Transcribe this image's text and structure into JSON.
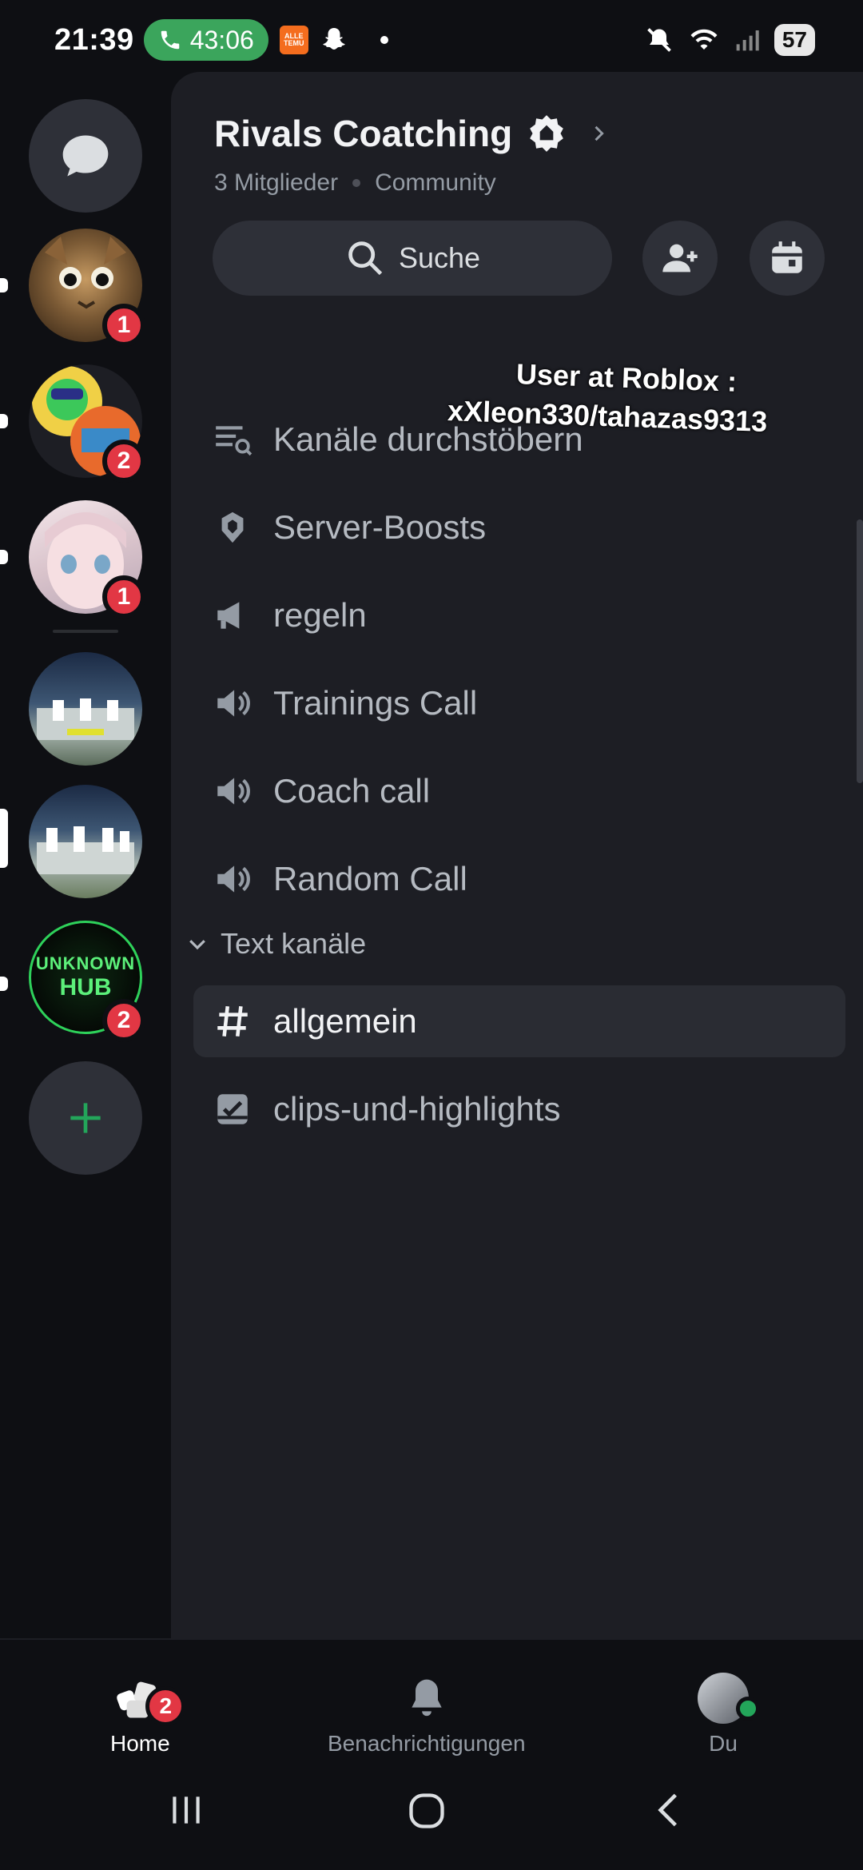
{
  "status_bar": {
    "time": "21:39",
    "call_timer": "43:06",
    "temu_label": "ALLE TEMU",
    "battery": "57"
  },
  "server": {
    "name": "Rivals Coatching",
    "members": "3 Mitglieder",
    "type": "Community"
  },
  "search": {
    "label": "Suche"
  },
  "rail": {
    "badges": [
      "1",
      "2",
      "1",
      "2"
    ],
    "hub_text_1": "UNKNOWN",
    "hub_text_2": "HUB"
  },
  "channels": [
    {
      "name": "Kanäle durchstöbern",
      "icon": "browse-channels-icon"
    },
    {
      "name": "Server-Boosts",
      "icon": "boost-icon"
    },
    {
      "name": "regeln",
      "icon": "announcement-icon"
    },
    {
      "name": "Trainings Call",
      "icon": "voice-icon"
    },
    {
      "name": "Coach call",
      "icon": "voice-icon"
    },
    {
      "name": "Random Call",
      "icon": "voice-icon"
    }
  ],
  "category": {
    "name": "Text kanäle"
  },
  "text_channels": [
    {
      "name": "allgemein",
      "icon": "hash-icon"
    },
    {
      "name": "clips-und-highlights",
      "icon": "forum-icon"
    }
  ],
  "overlay": {
    "line1": "User at Roblox :",
    "line2": "xXleon330/tahazas9313"
  },
  "bottom_nav": {
    "home": "Home",
    "home_badge": "2",
    "notifications": "Benachrichtigungen",
    "you": "Du"
  },
  "colors": {
    "accent_green": "#23a55a",
    "badge_red": "#e23744",
    "panel_bg": "#1d1e24"
  }
}
